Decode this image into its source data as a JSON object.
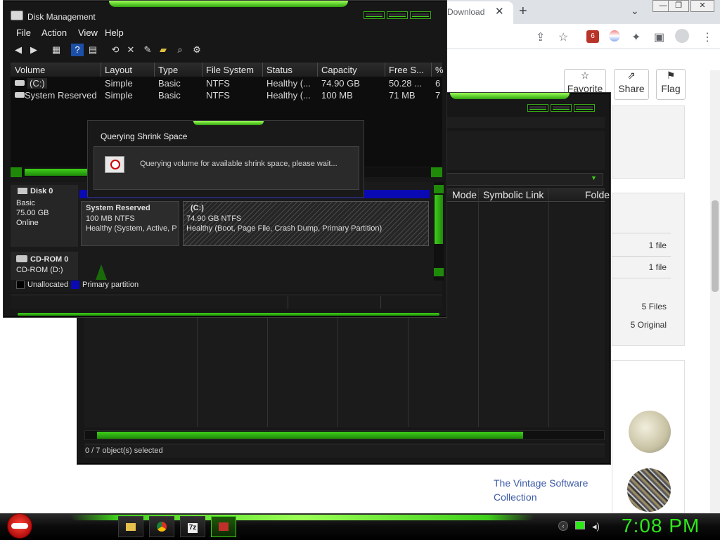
{
  "browser": {
    "tab_title": "Download",
    "tab_close": "✕",
    "new_tab": "+",
    "tab_search": "⌄",
    "window_controls": [
      "—",
      "❐",
      "✕"
    ],
    "toolbar_icons": [
      "share-icon",
      "star-icon",
      "extension-badge-icon",
      "extension-icon",
      "puzzle-icon",
      "sidebar-icon",
      "profile-icon",
      "menu-icon"
    ],
    "extension_badge": "6",
    "share_buttons": [
      "Favorite",
      "Share",
      "Flag"
    ],
    "panel_values": [
      "1 file",
      "1 file",
      "5 Files",
      "5 Original"
    ],
    "link_text": "The Vintage Software Collection"
  },
  "explorer": {
    "columns": [
      "Mode",
      "Symbolic Link",
      "Folde"
    ],
    "status_text": "0 / 7 object(s) selected"
  },
  "disk_management": {
    "title": "Disk Management",
    "menu": [
      "File",
      "Action",
      "View",
      "Help"
    ],
    "toolbar": [
      "back-icon",
      "forward-icon",
      "disk-list-icon",
      "help-icon",
      "properties-icon",
      "refresh-icon",
      "delete-icon",
      "edit-icon",
      "open-icon",
      "search-icon",
      "settings-icon"
    ],
    "list_columns": [
      "Volume",
      "Layout",
      "Type",
      "File System",
      "Status",
      "Capacity",
      "Free S...",
      "%"
    ],
    "volumes": [
      {
        "volume": "(C:)",
        "layout": "Simple",
        "type": "Basic",
        "fs": "NTFS",
        "status": "Healthy (...",
        "capacity": "74.90 GB",
        "free": "50.28 ...",
        "pct": "6"
      },
      {
        "volume": "System Reserved",
        "layout": "Simple",
        "type": "Basic",
        "fs": "NTFS",
        "status": "Healthy (...",
        "capacity": "100 MB",
        "free": "71 MB",
        "pct": "7"
      }
    ],
    "disk0": {
      "name": "Disk 0",
      "type": "Basic",
      "size": "75.00 GB",
      "state": "Online"
    },
    "partitions": [
      {
        "name": "System Reserved",
        "size": "100 MB NTFS",
        "status": "Healthy (System, Active, P"
      },
      {
        "name": "(C:)",
        "size": "74.90 GB NTFS",
        "status": "Healthy (Boot, Page File, Crash Dump, Primary Partition)"
      }
    ],
    "cdrom": {
      "name": "CD-ROM 0",
      "type": "CD-ROM (D:)"
    },
    "legend": [
      "Unallocated",
      "Primary partition"
    ]
  },
  "dialog": {
    "title": "Querying Shrink Space",
    "message": "Querying volume for available shrink space, please wait..."
  },
  "taskbar": {
    "clock": "7:08 PM",
    "apps": [
      "file-explorer-icon",
      "chrome-icon",
      "7zip-icon",
      "disk-management-icon"
    ],
    "seven_zip_label": "7z",
    "tray_icons": [
      "network-back-icon",
      "monitor-icon",
      "volume-icon"
    ]
  },
  "colors": {
    "accent_green": "#3fcf1b",
    "clock_green": "#2ee81a",
    "primary_partition_blue": "#0a0ab4",
    "link_blue": "#3b5aa8"
  }
}
